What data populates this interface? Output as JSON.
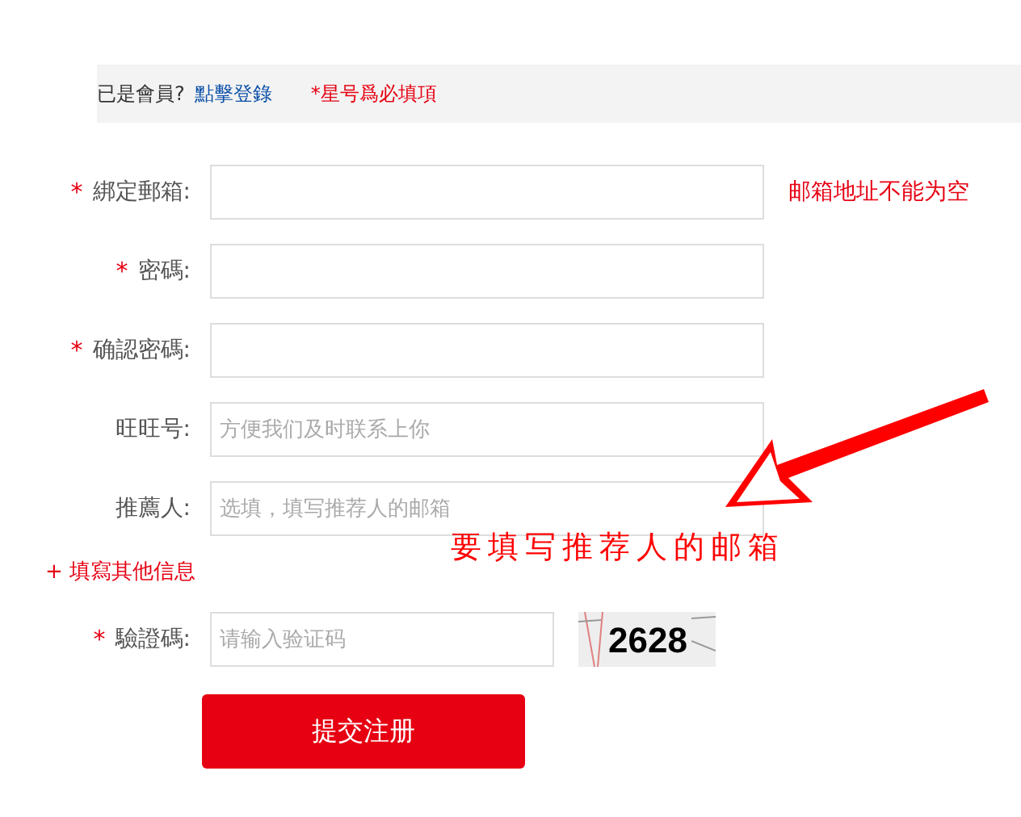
{
  "top_bar": {
    "member_prompt": "已是會員?",
    "login_link": "點擊登錄",
    "required_note": "*星号爲必填項"
  },
  "fields": [
    {
      "mark": "*",
      "label": "綁定郵箱:",
      "error": "邮箱地址不能为空"
    },
    {
      "mark": "*",
      "label": "密碼:"
    },
    {
      "mark": "*",
      "label": "确認密碼:"
    },
    {
      "label": "旺旺号:",
      "placeholder": "方便我们及时联系上你"
    },
    {
      "label": "推薦人:",
      "placeholder": "选填，填写推荐人的邮箱"
    }
  ],
  "more_info_link": "+ 填寫其他信息",
  "captcha": {
    "mark": "*",
    "label": "驗證碼:",
    "placeholder": "请输入验证码",
    "code": "2628"
  },
  "submit_button": "提交注册",
  "annotation": "要填写推荐人的邮箱"
}
